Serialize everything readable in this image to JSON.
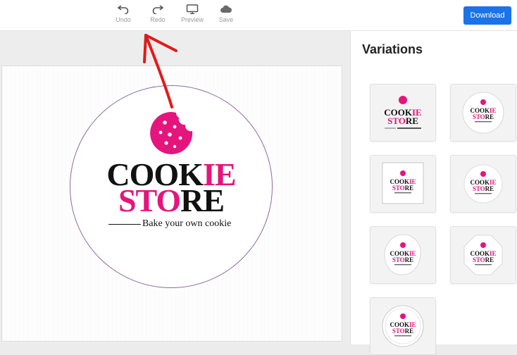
{
  "toolbar": {
    "undo_label": "Undo",
    "redo_label": "Redo",
    "preview_label": "Preview",
    "save_label": "Save",
    "download_label": "Download"
  },
  "logo": {
    "line1_black": "COOK",
    "line1_pink": "IE",
    "line2_pink": "STO",
    "line2_black": "RE",
    "tagline": "Bake your own cookie"
  },
  "variations": {
    "title": "Variations",
    "items": [
      {
        "style": "plain"
      },
      {
        "style": "circle"
      },
      {
        "style": "square"
      },
      {
        "style": "rounded-circle"
      },
      {
        "style": "blob"
      },
      {
        "style": "octagon"
      },
      {
        "style": "ring"
      }
    ]
  },
  "colors": {
    "accent": "#e4157d",
    "primary_button": "#1a73e8",
    "annotation_arrow": "#e01b1b",
    "circle_border": "#8e6aa0"
  }
}
